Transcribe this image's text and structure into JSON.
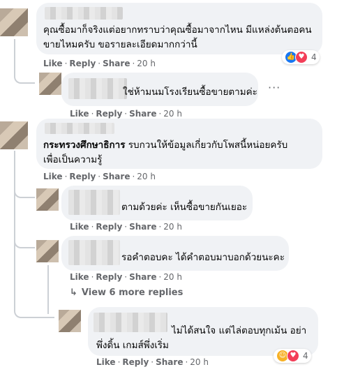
{
  "comments": [
    {
      "text_lines": [
        "คุณซื้อมาก็จริงแต่อยากทราบว่าคุณซื้อมาจากไหน มีแหล่งต้นตอคน",
        "ขายไหมครับ ขอรายละเอียดมากกว่านี้"
      ],
      "actions": {
        "like": "Like",
        "reply": "Reply",
        "share": "Share",
        "time": "20 h"
      },
      "reaction_count": "4"
    },
    {
      "text_lines": [
        "ใช่ห้ามนมโรงเรียนซื้อขายตามค่ะ"
      ],
      "actions": {
        "like": "Like",
        "reply": "Reply",
        "share": "Share",
        "time": "20 h"
      },
      "more_label": "···"
    },
    {
      "author": "กระทรวงศึกษาธิการ",
      "text_after_author": " รบกวนให้ข้อมูลเกี่ยวกับโพสนี้หน่อยครับ",
      "text_lines": [
        "เพื่อเป็นความรู้"
      ],
      "actions": {
        "like": "Like",
        "reply": "Reply",
        "share": "Share",
        "time": "20 h"
      }
    },
    {
      "text_lines": [
        "ตามด้วยค่ะ เห็นซื้อขายกันเยอะ"
      ],
      "actions": {
        "like": "Like",
        "reply": "Reply",
        "share": "Share",
        "time": "20 h"
      }
    },
    {
      "text_lines": [
        "รอคำตอบคะ ได้คำตอบมาบอกด้วยนะคะ"
      ],
      "actions": {
        "like": "Like",
        "reply": "Reply",
        "share": "Share",
        "time": "20 h"
      }
    },
    {
      "text_lines": [
        "ไม่ได้สนใจ แต่ไล่ตอบทุกเม้น อย่า",
        "พึ่งดิ้น เกมส์พึ่งเริ่ม"
      ],
      "actions": {
        "like": "Like",
        "reply": "Reply",
        "share": "Share",
        "time": "20 h"
      },
      "reaction_count": "4"
    }
  ],
  "view_more": {
    "arrow": "↳",
    "label": "View 6 more replies"
  },
  "reactions": {
    "like_color": "#1877f2",
    "love_color": "#f33e58",
    "haha_color": "#f7b125",
    "like_icon": "thumbs-up",
    "love_icon": "heart",
    "haha_icon": "laughing-face"
  }
}
